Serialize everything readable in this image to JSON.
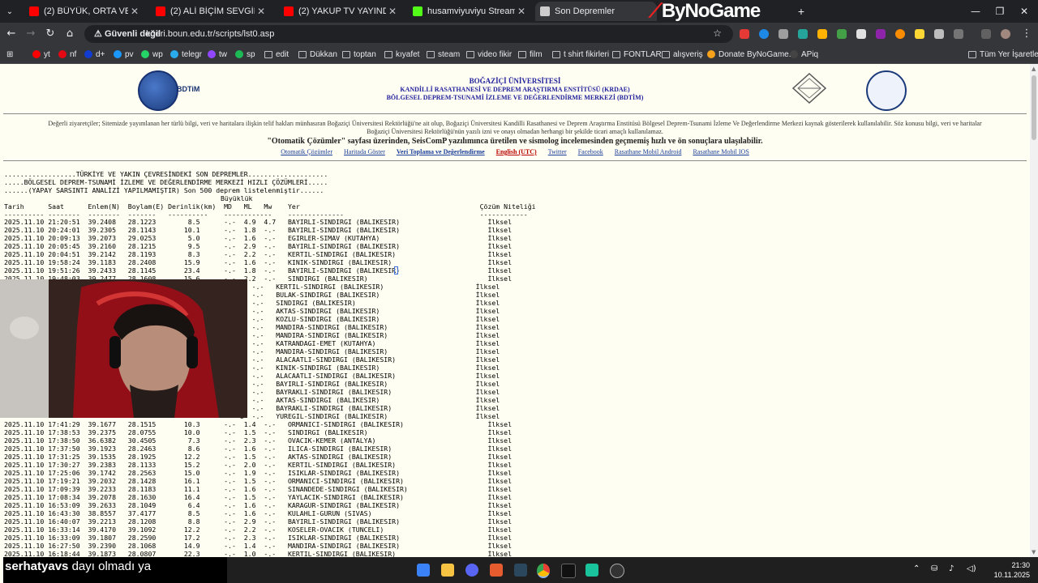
{
  "browser": {
    "tabs": [
      {
        "title": "(2) BÜYÜK, ORTA VEYA KÜÇÜK",
        "color": "#ff0000"
      },
      {
        "title": "(2) ALİ BİÇİM SEVGİLİSİNDEN A",
        "color": "#ff0000"
      },
      {
        "title": "(2) YAKUP TV YAYINDA EVİ KEB",
        "color": "#ff0000"
      },
      {
        "title": "husamviyuviyu Stream - Watch",
        "color": "#53fc18"
      },
      {
        "title": "Son Depremler",
        "color": "#cccccc"
      }
    ],
    "new_tab": "+",
    "brand": "ByNoGame",
    "security_label": "Güvenli değil",
    "url": "koeri.boun.edu.tr/scripts/lst0.asp"
  },
  "bookmarks": [
    "yt",
    "nf",
    "d+",
    "pv",
    "wp",
    "telegr",
    "tw",
    "sp",
    "edit",
    "Dükkan",
    "toptan",
    "kıyafet",
    "steam",
    "video fikir",
    "film",
    "t shirt fikirleri",
    "FONTLAR",
    "alışveriş",
    "Donate ByNoGame...",
    "APiq"
  ],
  "all_bookmarks": "Tüm Yer İşaretleri",
  "header": {
    "logo_text": "BDTiM",
    "line1": "BOĞAZİÇİ ÜNİVERSİTESİ",
    "line2": "KANDİLLİ RASATHANESİ VE DEPREM ARAŞTIRMA ENSTİTÜSÜ (KRDAE)",
    "line3": "BÖLGESEL DEPREM-TSUNAMİ İZLEME VE DEĞERLENDİRME MERKEZİ (BDTİM)"
  },
  "notice": {
    "line1": "Değerli ziyaretçiler; Sitemizde yayımlanan her türlü bilgi, veri ve haritalara ilişkin telif hakları münhasıran Boğaziçi Üniversitesi Rektörlüğü'ne ait olup, Boğaziçi Üniversitesi Kandilli Rasathanesi ve Deprem Araştırma Enstitüsü Bölgesel Deprem-Tsunami İzleme Ve Değerlendirme Merkezi kaynak gösterilerek kullanılabilir. Söz konusu bilgi, veri ve haritalar",
    "line2": "Boğaziçi Üniversitesi Rektörlüğü'nün yazılı izni ve onayı olmadan herhangi bir şekilde ticari amaçlı kullanılamaz.",
    "line3": "\"Otomatik Çözümler\" sayfası üzerinden, SeisComP yazılımınca üretilen ve sismolog incelemesinden geçmemiş hızlı ve ön sonuçlara ulaşılabilir."
  },
  "links": [
    "Otomatik Çözümler",
    "Haritada Göster",
    "Veri Toplama ve Değerlendirme",
    "English (UTC)",
    "Twitter",
    "Facebook",
    "Rasathane Mobil Android",
    "Rasathane Mobil IOS"
  ],
  "list": {
    "heading1": "..................TÜRKİYE VE YAKIN ÇEVRESİNDEKİ SON DEPREMLER....................",
    "heading2": ".....BÖLGESEL DEPREM-TSUNAMİ İZLEME VE DEĞERLENDİRME MERKEZİ HIZLI ÇÖZÜMLERİ.....",
    "heading3": "......(YAPAY SARSINTI ANALİZİ YAPILMAMIŞTIR) Son 500 deprem listelenmiştir......",
    "buyukluk": "Büyüklük",
    "columns": "Tarih      Saat      Enlem(N)  Boylam(E) Derinlik(km)  MD   ML   Mw    Yer                                             Çözüm Niteliği",
    "dashes": "---------- --------  --------  -------   ----------    ------------    --------------                                  ------------",
    "rows": [
      "2025.11.10 21:20:51  39.2408   28.1223        8.5      -.-  4.9  4.7   BAYIRLI-SINDIRGI (BALIKESIR)                      İlksel",
      "2025.11.10 20:24:01  39.2305   28.1143       10.1      -.-  1.8  -.-   BAYIRLI-SINDIRGI (BALIKESIR)                      İlksel",
      "2025.11.10 20:09:13  39.2073   29.0253        5.0      -.-  1.6  -.-   EGIRLER-SIMAV (KUTAHYA)                           İlksel",
      "2025.11.10 20:05:45  39.2160   28.1215        9.5      -.-  2.9  -.-   BAYIRLI-SINDIRGI (BALIKESIR)                      İlksel",
      "2025.11.10 20:04:51  39.2142   28.1193        8.3      -.-  2.2  -.-   KERTIL-SINDIRGI (BALIKESIR)                       İlksel",
      "2025.11.10 19:58:24  39.1183   28.2408       15.9      -.-  1.6  -.-   KINIK-SINDIRGI (BALIKESIR)                        İlksel",
      "2025.11.10 19:51:26  39.2433   28.1145       23.4      -.-  1.8  -.-   BAYIRLI-SINDIRGI (BALIKESIR)                      İlksel",
      "2025.11.10 19:48:03  39.2477   28.1608       15.6      -.-  2.2  -.-   SINDIRGI (BALIKESIR)                              İlksel",
      "                                                           0  -.-   KERTIL-SINDIRGI (BALIKESIR)                       İlksel",
      "                                                           5  -.-   BULAK-SINDIRGI (BALIKESIR)                        İlksel",
      "                                                           0  -.-   SINDIRGI (BALIKESIR)                              İlksel",
      "                                                           0  -.-   AKTAS-SINDIRGI (BALIKESIR)                        İlksel",
      "                                                           7  -.-   KOZLU-SINDIRGI (BALIKESIR)                        İlksel",
      "                                                           5  -.-   MANDIRA-SINDIRGI (BALIKESIR)                      İlksel",
      "                                                           1  -.-   MANDIRA-SINDIRGI (BALIKESIR)                      İlksel",
      "                                                           1  -.-   KATRANDAGI-EMET (KUTAHYA)                         İlksel",
      "                                                           7  -.-   MANDIRA-SINDIRGI (BALIKESIR)                      İlksel",
      "                                                           5  -.-   ALACAATLI-SINDIRGI (BALIKESIR)                    İlksel",
      "                                                           0  -.-   KINIK-SINDIRGI (BALIKESIR)                        İlksel",
      "                                                           0  -.-   ALACAATLI-SINDIRGI (BALIKESIR)                    İlksel",
      "                                                           0  -.-   BAYIRLI-SINDIRGI (BALIKESIR)                      İlksel",
      "                                                           4  -.-   BAYRAKLI-SINDIRGI (BALIKESIR)                     İlksel",
      "                                                           0  -.-   AKTAS-SINDIRGI (BALIKESIR)                        İlksel",
      "                                                           0  -.-   BAYRAKLI-SINDIRGI (BALIKESIR)                     İlksel",
      "                                                           8  -.-   YUREGIL-SINDIRGI (BALIKESIR)                      İlksel",
      "2025.11.10 17:41:29  39.1677   28.1515       10.3      -.-  1.4  -.-   ORMANICI-SINDIRGI (BALIKESIR)                     İlksel",
      "2025.11.10 17:38:53  39.2375   28.0755       10.0      -.-  1.5  -.-   SINDIRGI (BALIKESIR)                              İlksel",
      "2025.11.10 17:38:50  36.6382   30.4505        7.3      -.-  2.3  -.-   OVACIK-KEMER (ANTALYA)                            İlksel",
      "2025.11.10 17:37:50  39.1923   28.2463        8.6      -.-  1.6  -.-   ILICA-SINDIRGI (BALIKESIR)                        İlksel",
      "2025.11.10 17:31:25  39.1535   28.1925       12.2      -.-  1.5  -.-   AKTAS-SINDIRGI (BALIKESIR)                        İlksel",
      "2025.11.10 17:30:27  39.2383   28.1133       15.2      -.-  2.0  -.-   KERTIL-SINDIRGI (BALIKESIR)                       İlksel",
      "2025.11.10 17:25:06  39.1742   28.2563       15.0      -.-  1.9  -.-   ISIKLAR-SINDIRGI (BALIKESIR)                      İlksel",
      "2025.11.10 17:19:21  39.2032   28.1428       16.1      -.-  1.5  -.-   ORMANICI-SINDIRGI (BALIKESIR)                     İlksel",
      "2025.11.10 17:09:39  39.2233   28.1183       11.1      -.-  1.6  -.-   SINANDEDE-SINDIRGI (BALIKESIR)                    İlksel",
      "2025.11.10 17:08:34  39.2078   28.1630       16.4      -.-  1.5  -.-   YAYLACIK-SINDIRGI (BALIKESIR)                     İlksel",
      "2025.11.10 16:53:09  39.2633   28.1049        6.4      -.-  1.6  -.-   KARAGUR-SINDIRGI (BALIKESIR)                      İlksel",
      "2025.11.10 16:43:30  38.8557   37.4177        8.5      -.-  1.6  -.-   KULAHLI-GURUN (SIVAS)                             İlksel",
      "2025.11.10 16:40:07  39.2213   28.1208        8.8      -.-  2.9  -.-   BAYIRLI-SINDIRGI (BALIKESIR)                      İlksel",
      "2025.11.10 16:33:14  39.4170   39.1092       12.2      -.-  2.2  -.-   KOSELER-OVACIK (TUNCELI)                          İlksel",
      "2025.11.10 16:33:09  39.1807   28.2590       17.2      -.-  2.3  -.-   ISIKLAR-SINDIRGI (BALIKESIR)                      İlksel",
      "2025.11.10 16:27:50  39.2390   28.1068       14.9      -.-  1.4  -.-   MANDIRA-SINDIRGI (BALIKESIR)                      İlksel",
      "2025.11.10 16:18:44  39.1873   28.0807       22.3      -.-  1.0  -.-   KERTIL-SINDIRGI (BALIKESIR)                       İlksel"
    ]
  },
  "stream": {
    "chat_user": "serhatyavs",
    "chat_message": "dayı olmadı ya"
  },
  "taskbar": {
    "time": "21:30",
    "date": "10.11.2025"
  }
}
